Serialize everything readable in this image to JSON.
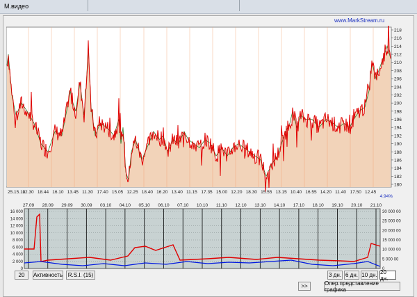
{
  "window": {
    "title": "М.видео"
  },
  "brand": "www.MarkStream.ru",
  "main_chart": {
    "y_ticks": [
      "218",
      "216",
      "214",
      "212",
      "210",
      "208",
      "206",
      "204",
      "202",
      "200",
      "198",
      "196",
      "194",
      "192",
      "190",
      "188",
      "186",
      "184",
      "182",
      "180"
    ],
    "x_ticks": [
      "25.15.10",
      "12.30",
      "18.44",
      "16.10",
      "13.45",
      "11.30",
      "17.40",
      "15.05",
      "12.25",
      "18.40",
      "16.20",
      "13.40",
      "11.15",
      "17.35",
      "15.00",
      "12.20",
      "18.30",
      "15.55",
      "13.15",
      "10.40",
      "16.55",
      "14.20",
      "11.40",
      "17.50",
      "12.45"
    ],
    "change_label": "4.94%",
    "colors": {
      "price_line": "#e00000",
      "ma_line": "#2f7d2f",
      "area_fill": "#f2d3b9",
      "bg": "#ffffff"
    }
  },
  "volume_chart": {
    "date_ticks": [
      "27.09",
      "28.09",
      "29.09",
      "30.09",
      "03.10",
      "04.10",
      "05.10",
      "06.10",
      "07.10",
      "10.10",
      "11.10",
      "12.10",
      "13.10",
      "14.10",
      "17.10",
      "18.10",
      "19.10",
      "20.10",
      "21.10"
    ],
    "left_axis": [
      "16 000",
      "14 000",
      "12 000",
      "10 000",
      "8 000",
      "6 000",
      "4 000",
      "2 000",
      "0"
    ],
    "right_axis": [
      "30 000 00",
      "25 000 00",
      "20 000 00",
      "15 000 00",
      "10 000 00",
      "5 000 00",
      "0"
    ],
    "colors": {
      "red_series": "#e00000",
      "blue_series": "#0018e0",
      "bg": "#c8d2d2"
    }
  },
  "controls": {
    "period": "20",
    "activity": "Активность",
    "rsi": "R.S.I.  (15)",
    "d3": "3 дн.",
    "d6": "6 дн.",
    "d10": "10 дн.",
    "d20": "20 дн.",
    "next": ">>",
    "operative": "Опер.представление графика"
  }
}
